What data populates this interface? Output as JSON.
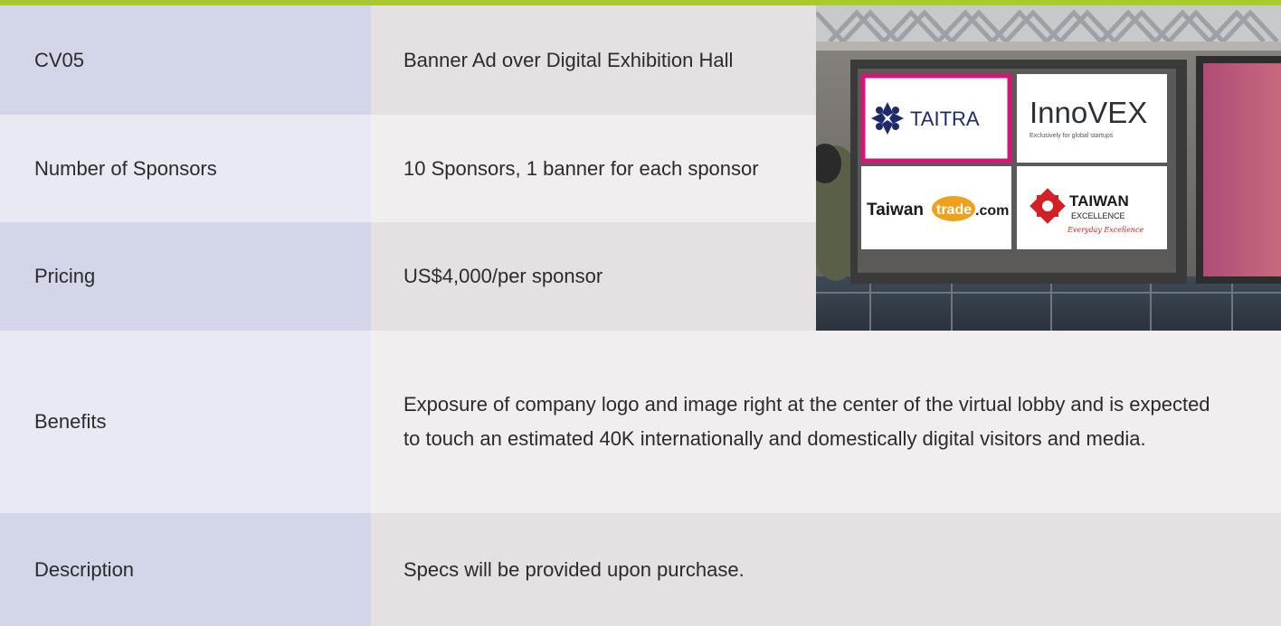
{
  "rows": [
    {
      "label": "CV05",
      "value": "Banner Ad over Digital Exhibition Hall"
    },
    {
      "label": "Number of Sponsors",
      "value": "10 Sponsors, 1 banner for each sponsor"
    },
    {
      "label": "Pricing",
      "value": "US$4,000/per sponsor"
    },
    {
      "label": "Benefits",
      "value": "Exposure of company logo and image right at the center of the virtual lobby and is expected to touch an estimated 40K internationally and domestically digital visitors and media."
    },
    {
      "label": "Description",
      "value": "Specs will be provided upon purchase."
    }
  ],
  "billboard": {
    "logos": {
      "taitra": "TAITRA",
      "innovex": "InnoVEX",
      "innovex_tagline": "Exclusively for global startups",
      "taiwantrade_left": "Taiwan",
      "taiwantrade_mid": "trade",
      "taiwantrade_right": ".com",
      "excellence_title": "TAIWAN",
      "excellence_sub": "EXCELLENCE",
      "excellence_script": "Everyday Excellence"
    }
  },
  "colors": {
    "accent_bar": "#a9c92c",
    "highlight_border": "#d6147a"
  }
}
